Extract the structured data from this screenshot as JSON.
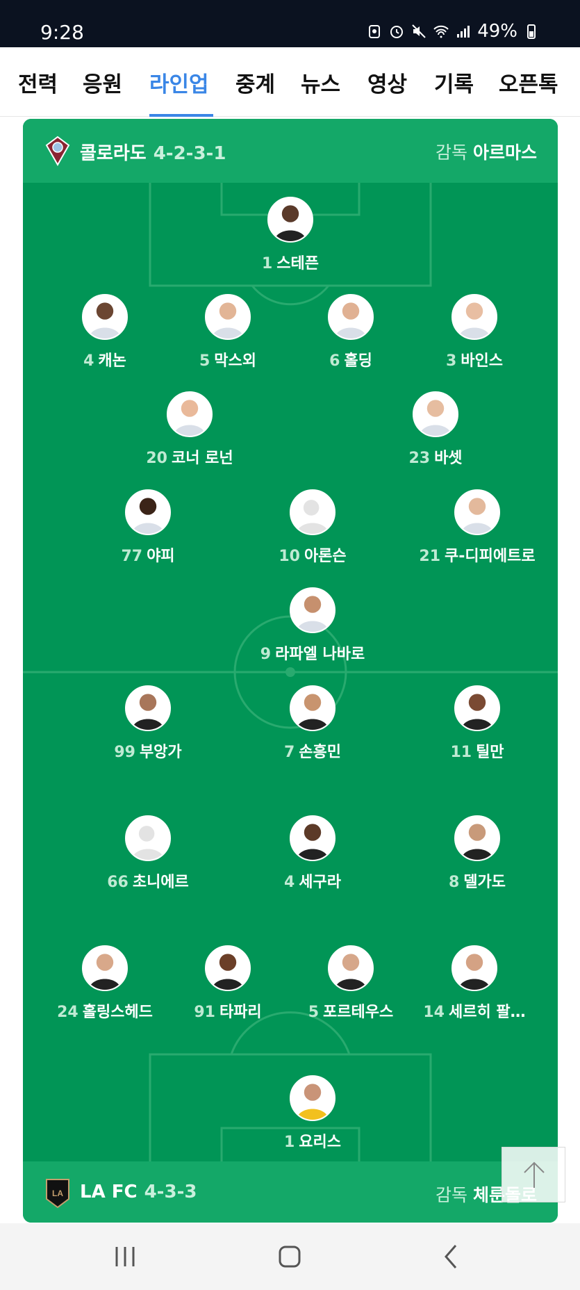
{
  "status_bar": {
    "time": "9:28",
    "battery": "49%"
  },
  "tabs": [
    {
      "label": "전력"
    },
    {
      "label": "응원"
    },
    {
      "label": "라인업"
    },
    {
      "label": "중계"
    },
    {
      "label": "뉴스"
    },
    {
      "label": "영상"
    },
    {
      "label": "기록"
    },
    {
      "label": "오픈톡"
    }
  ],
  "active_tab": "라인업",
  "home": {
    "team": "콜로라도",
    "formation": "4-2-3-1",
    "coach_label": "감독",
    "coach": "아르마스",
    "players": [
      {
        "num": "1",
        "name": "스테픈"
      },
      {
        "num": "4",
        "name": "캐논"
      },
      {
        "num": "5",
        "name": "막스외"
      },
      {
        "num": "6",
        "name": "홀딩"
      },
      {
        "num": "3",
        "name": "바인스"
      },
      {
        "num": "20",
        "name": "코너 로넌"
      },
      {
        "num": "23",
        "name": "바셋"
      },
      {
        "num": "77",
        "name": "야피"
      },
      {
        "num": "10",
        "name": "아론슨"
      },
      {
        "num": "21",
        "name": "쿠-디피에트로"
      },
      {
        "num": "9",
        "name": "라파엘 나바로"
      }
    ]
  },
  "away": {
    "team": "LA FC",
    "formation": "4-3-3",
    "coach_label": "감독",
    "coach": "체룬돌로",
    "players": [
      {
        "num": "99",
        "name": "부앙가"
      },
      {
        "num": "7",
        "name": "손흥민"
      },
      {
        "num": "11",
        "name": "틸만"
      },
      {
        "num": "66",
        "name": "초니에르"
      },
      {
        "num": "4",
        "name": "세구라"
      },
      {
        "num": "8",
        "name": "델가도"
      },
      {
        "num": "24",
        "name": "홀링스헤드"
      },
      {
        "num": "91",
        "name": "타파리"
      },
      {
        "num": "5",
        "name": "포르테우스"
      },
      {
        "num": "14",
        "name": "세르히 팔…"
      },
      {
        "num": "1",
        "name": "요리스"
      }
    ]
  },
  "colors": {
    "pitch": "#019556",
    "bar": "#14a868",
    "accent": "#3a86e6"
  },
  "icons": [
    "notification-icon",
    "alarm-icon",
    "mute-icon",
    "wifi-icon",
    "signal-icon",
    "battery-icon",
    "arrow-up-icon",
    "recent-apps-icon",
    "home-icon",
    "back-icon"
  ]
}
